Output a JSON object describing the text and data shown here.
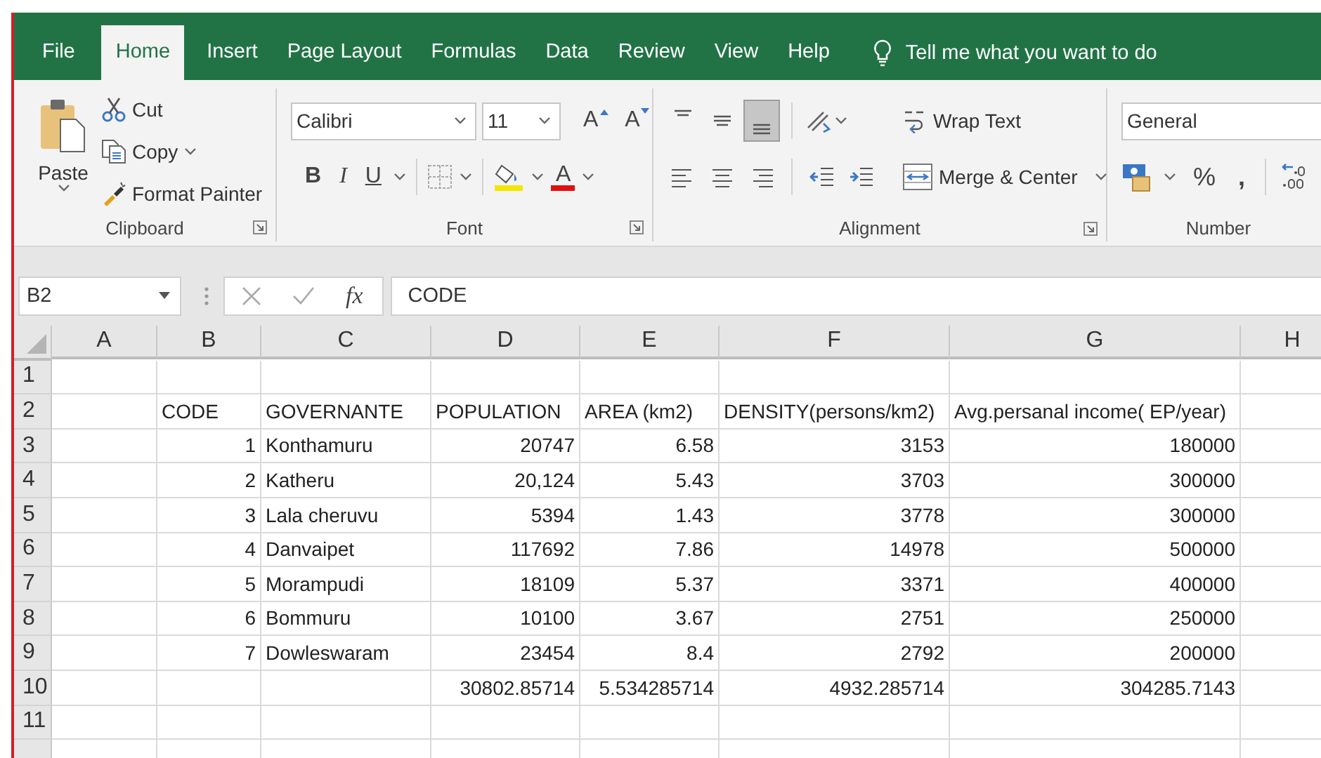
{
  "tabs": [
    {
      "label": "File",
      "selected": false
    },
    {
      "label": "Home",
      "selected": true
    },
    {
      "label": "Insert",
      "selected": false
    },
    {
      "label": "Page Layout",
      "selected": false
    },
    {
      "label": "Formulas",
      "selected": false
    },
    {
      "label": "Data",
      "selected": false
    },
    {
      "label": "Review",
      "selected": false
    },
    {
      "label": "View",
      "selected": false
    },
    {
      "label": "Help",
      "selected": false
    }
  ],
  "tell_me": "Tell me what you want to do",
  "ribbon": {
    "clipboard": {
      "paste": "Paste",
      "cut": "Cut",
      "copy": "Copy",
      "format_painter": "Format Painter",
      "label": "Clipboard"
    },
    "font": {
      "font_name": "Calibri",
      "font_size": "11",
      "grow_font": "A",
      "shrink_font": "A",
      "style_buttons": [
        {
          "kind": "bold",
          "label": "B"
        },
        {
          "kind": "italic",
          "label": "I"
        },
        {
          "kind": "underline",
          "label": "U"
        }
      ],
      "font_color": "A",
      "label": "Font"
    },
    "alignment": {
      "vertical_align": [
        {
          "kind": "top",
          "selected": false
        },
        {
          "kind": "middle",
          "selected": false
        },
        {
          "kind": "bottom",
          "selected": true
        }
      ],
      "wrap_text": "Wrap Text",
      "merge_center": "Merge & Center",
      "label": "Alignment"
    },
    "number": {
      "format": "General",
      "percent": "%",
      "comma": ",",
      "label": "Number"
    }
  },
  "formula_bar": {
    "name_box": "B2",
    "function_button": "fx",
    "formula": "CODE"
  },
  "sheet": {
    "columns": [
      {
        "label": "A",
        "kind": "text"
      },
      {
        "label": "B",
        "kind": "number"
      },
      {
        "label": "C",
        "kind": "text"
      },
      {
        "label": "D",
        "kind": "number"
      },
      {
        "label": "E",
        "kind": "number"
      },
      {
        "label": "F",
        "kind": "number"
      },
      {
        "label": "G",
        "kind": "number"
      },
      {
        "label": "H",
        "kind": "text"
      }
    ],
    "rows": [
      {
        "number": "1",
        "kind": "data"
      },
      {
        "number": "2",
        "kind": "header",
        "cells": [
          null,
          "CODE",
          "GOVERNANTE",
          "POPULATION",
          "AREA (km2)",
          "DENSITY(persons/km2)",
          "Avg.persanal income( EP/year)"
        ]
      },
      {
        "number": "3",
        "kind": "data",
        "cells": [
          null,
          "1",
          "Konthamuru",
          "20747",
          "6.58",
          "3153",
          "180000"
        ]
      },
      {
        "number": "4",
        "kind": "data",
        "cells": [
          null,
          "2",
          "Katheru",
          "20,124",
          "5.43",
          "3703",
          "300000"
        ]
      },
      {
        "number": "5",
        "kind": "data",
        "cells": [
          null,
          "3",
          "Lala cheruvu",
          "5394",
          "1.43",
          "3778",
          "300000"
        ]
      },
      {
        "number": "6",
        "kind": "data",
        "cells": [
          null,
          "4",
          "Danvaipet",
          "117692",
          "7.86",
          "14978",
          "500000"
        ]
      },
      {
        "number": "7",
        "kind": "data",
        "cells": [
          null,
          "5",
          "Morampudi",
          "18109",
          "5.37",
          "3371",
          "400000"
        ]
      },
      {
        "number": "8",
        "kind": "data",
        "cells": [
          null,
          "6",
          "Bommuru",
          "10100",
          "3.67",
          "2751",
          "250000"
        ]
      },
      {
        "number": "9",
        "kind": "data",
        "cells": [
          null,
          "7",
          "Dowleswaram",
          "23454",
          "8.4",
          "2792",
          "200000"
        ]
      },
      {
        "number": "10",
        "kind": "data",
        "cells": [
          null,
          null,
          null,
          "30802.85714",
          "5.534285714",
          "4932.285714",
          "304285.7143"
        ]
      },
      {
        "number": "11",
        "kind": "data"
      }
    ]
  }
}
